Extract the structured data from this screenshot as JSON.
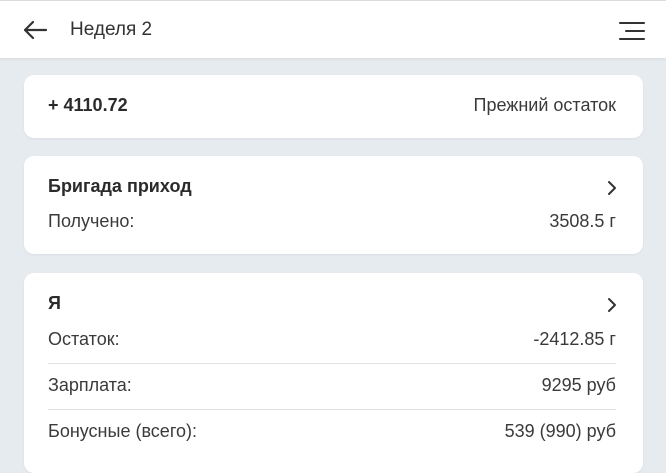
{
  "header": {
    "title": "Неделя 2",
    "back_icon": "arrow-left-icon",
    "menu_icon": "menu-icon"
  },
  "balance": {
    "amount": "+ 4110.72",
    "label": "Прежний остаток"
  },
  "brigade": {
    "heading": "Бригада приход",
    "rows": [
      {
        "label": "Получено:",
        "value": "3508.5 г"
      }
    ]
  },
  "me": {
    "heading": "Я",
    "rows": [
      {
        "label": "Остаток:",
        "value": "-2412.85 г"
      },
      {
        "label": "Зарплата:",
        "value": "9295 руб"
      },
      {
        "label": "Бонусные (всего):",
        "value": "539 (990) руб"
      }
    ]
  },
  "colors": {
    "background": "#e6ebef",
    "card": "#ffffff",
    "text": "#2b2b2b"
  }
}
